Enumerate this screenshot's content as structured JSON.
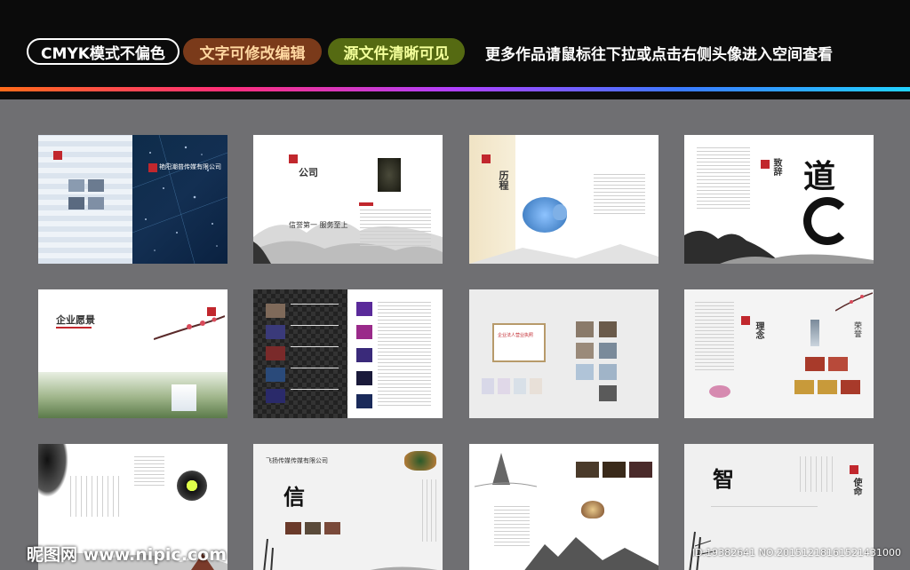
{
  "header": {
    "badge_cmyk": "CMYK模式不偏色",
    "badge_editable": "文字可修改编辑",
    "badge_source": "源文件清晰可见",
    "slogan": "更多作品请鼠标往下拉或点击右侧头像进入空间查看"
  },
  "thumbnails": {
    "t1": {
      "company": "艳阳潮普传媒有限公司"
    },
    "t2": {
      "heading": "公司",
      "motto": "信誉第一 服务至上"
    },
    "t3": {
      "heading": "历程"
    },
    "t4": {
      "heading": "致辞",
      "calligraphy": "道"
    },
    "t5": {
      "heading": "企业愿景"
    },
    "t7": {
      "stamp": "企业法人营业执照"
    },
    "t8": {
      "heading": "理念",
      "award": "荣誉"
    },
    "t10": {
      "company": "飞扬传媒传媒有限公司",
      "calligraphy": "信"
    },
    "t12": {
      "calligraphy": "智",
      "heading": "使命"
    }
  },
  "watermark": {
    "logo": "昵图网 www.nipic.com",
    "id_text": "ID:19382641 NO:20151218161521431000"
  },
  "colors": {
    "accent_red": "#c1272d",
    "background": "#6f6f72"
  }
}
